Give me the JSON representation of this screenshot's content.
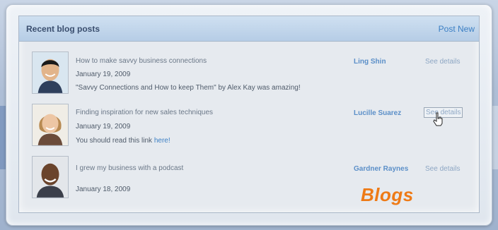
{
  "panel": {
    "title": "Recent blog posts",
    "post_new_label": "Post New"
  },
  "posts": [
    {
      "title": "How to make savvy business connections",
      "date": "January 19, 2009",
      "excerpt": "\"Savvy Connections and How to keep Them\" by Alex Kay was amazing!",
      "excerpt_link": "",
      "author": "Ling Shin",
      "details_label": "See details"
    },
    {
      "title": "Finding inspiration for new sales techniques",
      "date": "January 19, 2009",
      "excerpt": "You should read this link ",
      "excerpt_link": "here!",
      "author": "Lucille Suarez",
      "details_label": "See details"
    },
    {
      "title": "I grew my business with a podcast",
      "date": "January 18, 2009",
      "excerpt": "",
      "excerpt_link": "",
      "author": "Gardner Raynes",
      "details_label": "See details"
    }
  ],
  "overlay_label": "Blogs",
  "colors": {
    "accent": "#3b7fc4",
    "overlay": "#ee7a16",
    "header": "#b6cde6"
  },
  "icons": [
    "avatar-ling-shin",
    "avatar-lucille-suarez",
    "avatar-gardner-raynes",
    "hand-pointer-cursor-icon"
  ]
}
